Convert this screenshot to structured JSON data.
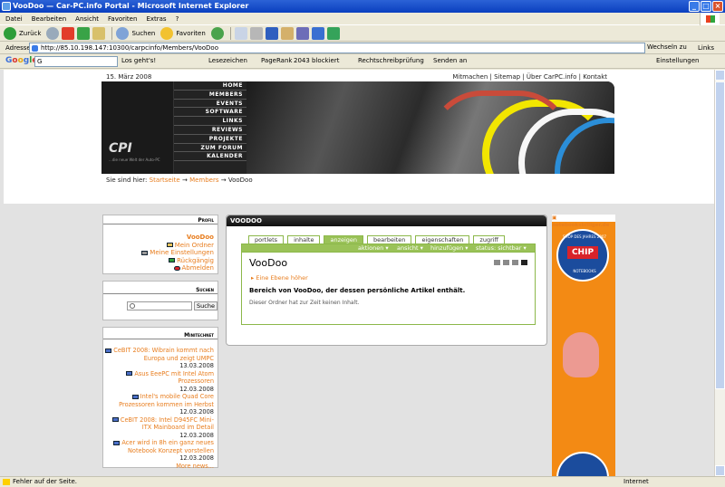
{
  "window": {
    "title": "VooDoo — Car-PC.info Portal - Microsoft Internet Explorer"
  },
  "menu": [
    "Datei",
    "Bearbeiten",
    "Ansicht",
    "Favoriten",
    "Extras",
    "?"
  ],
  "toolbar": {
    "back": "Zurück",
    "search": "Suchen",
    "favorites": "Favoriten"
  },
  "address": {
    "label": "Adresse",
    "url": "http://85.10.198.147:10300/carpcinfo/Members/VooDoo",
    "go": "Wechseln zu",
    "links": "Links"
  },
  "googlebar": {
    "search_value": "G",
    "go": "Los geht's!",
    "bookmarks": "Lesezeichen",
    "pagerank": "PageRank",
    "blocked": "2043 blockiert",
    "spell": "Rechtschreibprüfung",
    "send": "Senden an",
    "settings": "Einstellungen"
  },
  "page": {
    "date": "15. März 2008",
    "toplinks": "Mitmachen | Sitemap | Über CarPC.info | Kontakt",
    "logo_text": "CPI",
    "logo_slogan": "...die neue Welt der Auto-PC",
    "nav": [
      "HOME",
      "MEMBERS",
      "EVENTS",
      "SOFTWARE",
      "LINKS",
      "REVIEWS",
      "PROJEKTE",
      "ZUM FORUM",
      "KALENDER"
    ],
    "breadcrumb": {
      "prefix": "Sie sind hier:",
      "home": "Startseite",
      "arrow1": "→",
      "members": "Members",
      "arrow2": "→",
      "current": "VooDoo"
    }
  },
  "profil": {
    "title": "Profil",
    "user": "VooDoo",
    "items": [
      "Mein Ordner",
      "Meine Einstellungen",
      "Rückgängig",
      "Abmelden"
    ]
  },
  "suchen": {
    "title": "Suchen",
    "button": "Suche"
  },
  "minitechnet": {
    "title": "Minitechnet",
    "news": [
      {
        "title": "CeBIT 2008: Wibrain kommt nach Europa und zeigt UMPC",
        "date": "13.03.2008"
      },
      {
        "title": "Asus EeePC mit Intel Atom Prozessoren",
        "date": "12.03.2008"
      },
      {
        "title": "Intel's mobile Quad Core Prozessoren kommen im Herbst",
        "date": "12.03.2008"
      },
      {
        "title": "CeBIT 2008: Intel D945FC Mini-ITX Mainboard im Detail",
        "date": "12.03.2008"
      },
      {
        "title": "Acer wird in 8h ein ganz neues Notebook Konzept vorstellen",
        "date": "12.03.2008"
      }
    ],
    "more": "More news..."
  },
  "main": {
    "header": "VOODOO",
    "tabs": [
      "portlets",
      "inhalte",
      "anzeigen",
      "bearbeiten",
      "eigenschaften",
      "zugriff"
    ],
    "actions": [
      "aktionen ▾",
      "ansicht ▾",
      "hinzufügen ▾",
      "status: sichtbar ▾"
    ],
    "title": "VooDoo",
    "up": "Eine Ebene höher",
    "description": "Bereich von VooDoo, der dessen persönliche Artikel enthält.",
    "empty": "Dieser Ordner hat zur Zeit keinen Inhalt."
  },
  "ad": {
    "source": "notebooksbilliger.de",
    "seal_top": "SHOP DES JAHRES 2007",
    "chip": "CHIP",
    "seal_bottom": "NOTEBOOKS"
  },
  "status": {
    "left": "Fehler auf der Seite.",
    "zone": "Internet"
  }
}
